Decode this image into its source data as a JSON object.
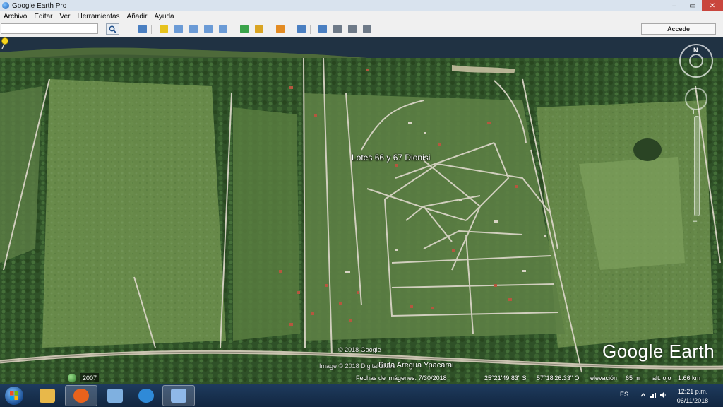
{
  "window": {
    "title": "Google Earth Pro",
    "controls": {
      "minimize": "–",
      "maximize": "▭",
      "close": "✕"
    }
  },
  "menu": [
    "Archivo",
    "Editar",
    "Ver",
    "Herramientas",
    "Añadir",
    "Ayuda"
  ],
  "toolbar": {
    "search_value": "",
    "search_icon": "magnifier-icon",
    "signin_label": "Accede",
    "buttons": [
      {
        "name": "sidebar-toggle-icon",
        "color": "#4a7fc1"
      },
      {
        "name": "add-placemark-icon",
        "color": "#e6c21d"
      },
      {
        "name": "add-polygon-icon",
        "color": "#6b9bd6"
      },
      {
        "name": "add-path-icon",
        "color": "#6b9bd6"
      },
      {
        "name": "add-overlay-icon",
        "color": "#6b9bd6"
      },
      {
        "name": "record-tour-icon",
        "color": "#6b9bd6"
      },
      {
        "name": "historical-imagery-icon",
        "color": "#3aa34a"
      },
      {
        "name": "sunlight-icon",
        "color": "#d9a422"
      },
      {
        "name": "switch-sky-icon",
        "color": "#e38b22"
      },
      {
        "name": "ruler-icon",
        "color": "#4a7fc1"
      },
      {
        "name": "email-icon",
        "color": "#4a7fc1"
      },
      {
        "name": "print-icon",
        "color": "#6e7a88"
      },
      {
        "name": "save-image-icon",
        "color": "#6e7a88"
      },
      {
        "name": "view-in-maps-icon",
        "color": "#6e7a88"
      }
    ]
  },
  "map": {
    "placemark_label": "Lotes 66 y 67 Dionisi",
    "copyright": "© 2018 Google",
    "road_label": "Ruta Aregua Ypacarai",
    "image_credit": "Image © 2018 DigitalGlobe",
    "watermark": "Google Earth",
    "compass_north": "N",
    "zoom_plus": "+",
    "zoom_minus": "–"
  },
  "history": {
    "year": "2007"
  },
  "status": {
    "imagery_date": "Fechas de imágenes: 7/30/2018",
    "latitude": "25°21'49.83\" S",
    "longitude": "57°18'26.33\" O",
    "elevation_label": "elevación",
    "elevation_value": "65 m",
    "eye_alt_label": "alt. ojo",
    "eye_alt_value": "1.66 km"
  },
  "taskbar": {
    "apps": [
      {
        "name": "explorer-icon",
        "color": "#e8b84a",
        "active": false
      },
      {
        "name": "firefox-icon",
        "color": "#e8621c",
        "active": true
      },
      {
        "name": "calculator-icon",
        "color": "#7fb0e0",
        "active": false
      },
      {
        "name": "media-player-icon",
        "color": "#2f8ad8",
        "active": false
      },
      {
        "name": "google-earth-icon",
        "color": "#8fb8e8",
        "active": true
      }
    ],
    "language": "ES",
    "time": "12:21 p.m.",
    "date": "06/11/2018"
  }
}
